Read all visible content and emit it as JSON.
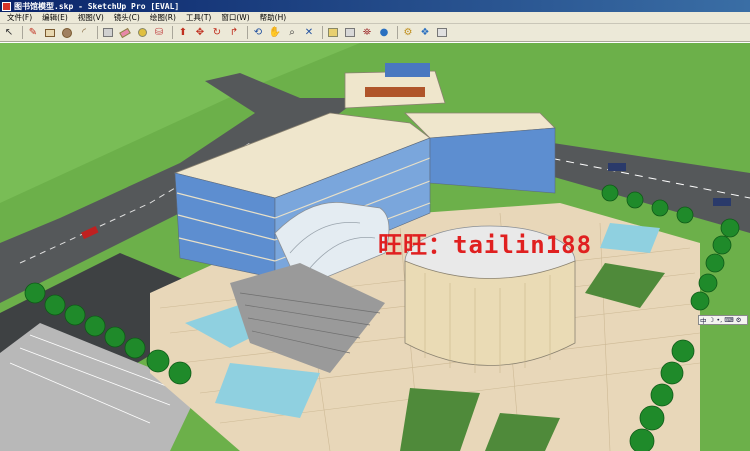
{
  "window": {
    "title": "图书馆模型.skp - SketchUp Pro [EVAL]"
  },
  "menu": {
    "items": [
      "文件(F)",
      "编辑(E)",
      "视图(V)",
      "镜头(C)",
      "绘图(R)",
      "工具(T)",
      "窗口(W)",
      "帮助(H)"
    ]
  },
  "toolbar": {
    "groups": [
      [
        "select-icon"
      ],
      [
        "pencil-icon",
        "rectangle-icon",
        "circle-icon",
        "arc-icon"
      ],
      [
        "make-component-icon",
        "eraser-icon",
        "tape-measure-icon",
        "paint-bucket-icon"
      ],
      [
        "push-pull-icon",
        "move-icon",
        "rotate-icon",
        "follow-me-icon"
      ],
      [
        "orbit-icon",
        "pan-icon",
        "zoom-icon",
        "zoom-extents-icon"
      ],
      [
        "add-location-icon",
        "toggle-terrain-icon",
        "preview-google-earth-icon",
        "get-models-icon"
      ],
      [
        "share-model-icon",
        "share-component-icon",
        "get-photo-texture-icon"
      ]
    ]
  },
  "watermark": {
    "text": "旺旺：tailin188"
  },
  "ime": {
    "label": "中"
  },
  "colors": {
    "title_start": "#0a246a",
    "title_end": "#3a6ea5",
    "chrome": "#ece9d8",
    "grass": "#6cb04a",
    "road": "#55585a",
    "plaza": "#e8d7b9",
    "building_wall": "#efe6cc",
    "glass": "#5d8ed0",
    "watermark": "#e02020"
  }
}
